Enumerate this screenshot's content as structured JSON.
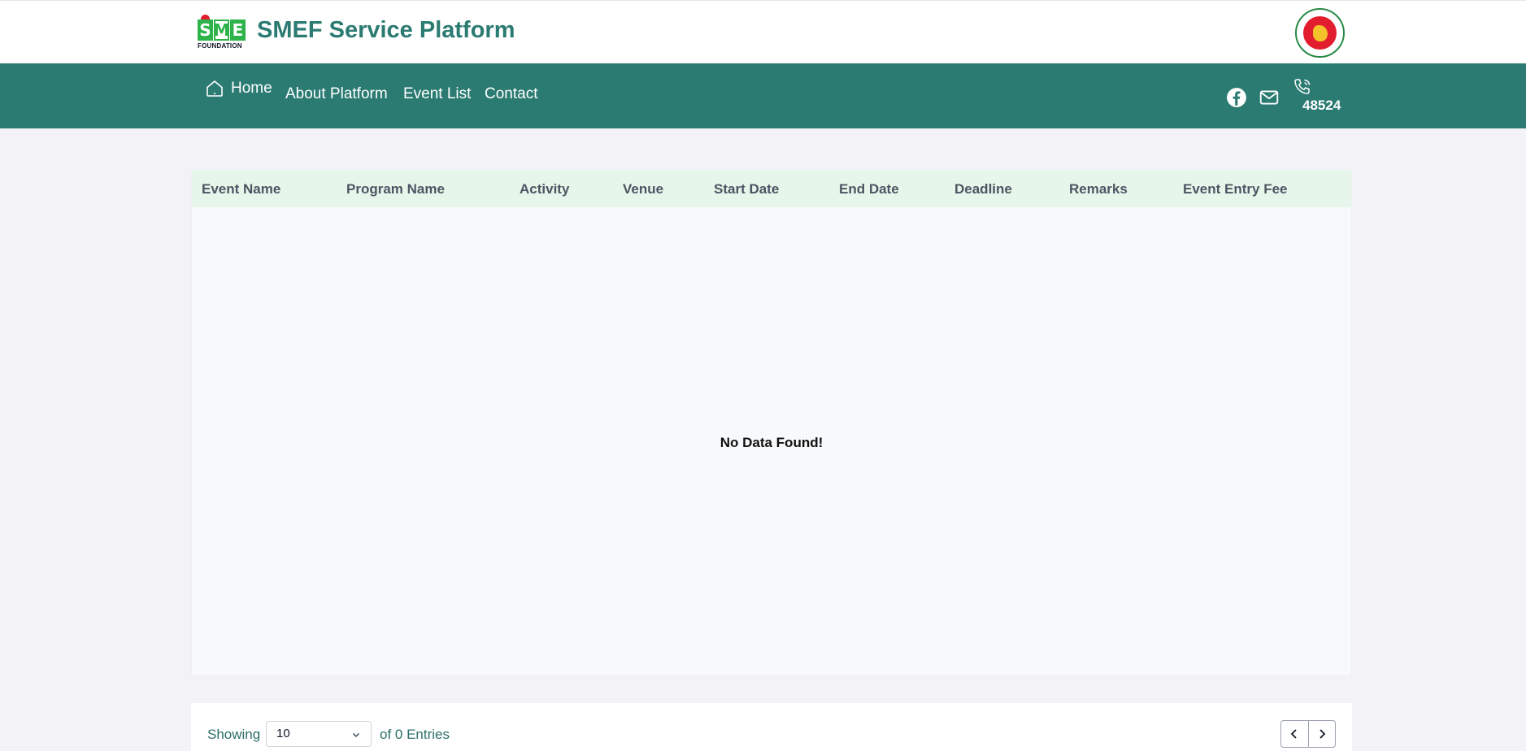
{
  "header": {
    "logo_letters": [
      "S",
      "M",
      "E"
    ],
    "logo_subtext": "FOUNDATION",
    "title": "SMEF Service Platform"
  },
  "nav": {
    "home": "Home",
    "about": "About Platform",
    "events": "Event List",
    "contact": "Contact",
    "phone": "48524"
  },
  "table": {
    "columns": [
      "Event Name",
      "Program Name",
      "Activity",
      "Venue",
      "Start Date",
      "End Date",
      "Deadline",
      "Remarks",
      "Event Entry Fee"
    ],
    "empty_message": "No Data Found!"
  },
  "pagination": {
    "showing_label": "Showing",
    "page_size": "10",
    "entries_label": "of 0 Entries"
  },
  "colors": {
    "brand": "#2b7b72",
    "header_row": "#e7f6ea",
    "logo_green": "#2db34a",
    "logo_red": "#e11d2e"
  },
  "icons": {
    "home": "home-icon",
    "facebook": "facebook-icon",
    "mail": "mail-icon",
    "phone": "phone-icon",
    "chevron": "chevron-down-icon",
    "prev": "chevron-left-icon",
    "next": "chevron-right-icon"
  }
}
